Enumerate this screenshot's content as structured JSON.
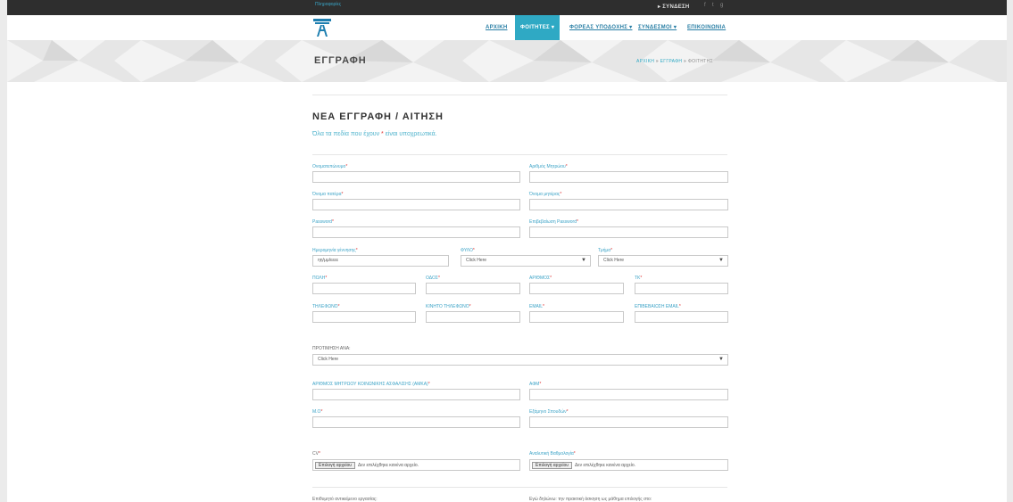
{
  "topbar": {
    "hint": "Πληροφορίες",
    "login_label": "ΣΥΝΔΕΣΗ",
    "social": [
      "f",
      "t",
      "g"
    ]
  },
  "nav": {
    "items": [
      {
        "label": "ΑΡΧΙΚΗ"
      },
      {
        "label": "ΦΟΙΤΗΤΕΣ ▾"
      },
      {
        "label": "ΦΟΡΕΑΣ ΥΠΟΔΟΧΗΣ ▾"
      },
      {
        "label": "ΣΥΝΔΕΣΜΟΙ ▾"
      },
      {
        "label": "ΕΠΙΚΟΙΝΩΝΙΑ"
      }
    ]
  },
  "banner": {
    "title": "ΕΓΓΡΑΦΗ",
    "crumb_1": "ΑΡΧΙΚΗ",
    "crumb_2": "ΕΓΓΡΑΦΗ",
    "crumb_3": "ΦΟΙΤΗΤΗΣ",
    "separator": "»"
  },
  "form": {
    "title": "ΝΕΑ ΕΓΓΡΑΦΗ / ΑΙΤΗΣΗ",
    "subtitle_before": "Όλα τα πεδία που έχουν ",
    "subtitle_star": "*",
    "subtitle_after": " είναι υποχρεωτικά.",
    "required_mark": "*",
    "fields": {
      "fullname": {
        "label": "Ονοματεπώνυμο",
        "value": ""
      },
      "reg_number": {
        "label": "Αριθμός Μητρώου",
        "value": ""
      },
      "father_name": {
        "label": "Όνομα πατέρα",
        "value": ""
      },
      "mother_name": {
        "label": "Όνομα μητέρας",
        "value": ""
      },
      "password": {
        "label": "Password",
        "value": ""
      },
      "password_confirm": {
        "label": "Επιβεβαίωση Password",
        "value": ""
      },
      "birth_date": {
        "label": "Ημερομηνία γέννησης",
        "value": "",
        "placeholder": "ηη/μμ/εεεε"
      },
      "gender": {
        "label": "ΦΥΛΟ",
        "value": "Click Here"
      },
      "department": {
        "label": "Τμήμα",
        "value": "Click Here"
      },
      "city": {
        "label": "ΠΟΛΗ",
        "value": ""
      },
      "street": {
        "label": "ΟΔΟΣ",
        "value": ""
      },
      "number": {
        "label": "ΑΡΙΘΜΟΣ",
        "value": ""
      },
      "zip": {
        "label": "ΤΚ",
        "value": ""
      },
      "phone": {
        "label": "ΤΗΛΕΦΩΝΟ",
        "value": ""
      },
      "mobile": {
        "label": "ΚΙΝΗΤΟ ΤΗΛΕΦΩΝΟ",
        "value": ""
      },
      "email": {
        "label": "EMAIL",
        "value": ""
      },
      "email_confirm": {
        "label": "ΕΠΙΒΕΒΑΙΩΣΗ EMAIL",
        "value": ""
      },
      "preference": {
        "label": "ΠΡΟΤΙΜΗΣΗ ΑΝΑ:",
        "value": "Click Here"
      },
      "amka": {
        "label": "ΑΡΙΘΜΟΣ ΜΗΤΡΩΟΥ ΚΟΙΝΩΝΙΚΗΣ ΑΣΦΑΛΙΣΗΣ (ΑΜΚΑ)",
        "value": ""
      },
      "afm": {
        "label": "ΑΦΜ",
        "value": ""
      },
      "gpa": {
        "label": "Μ.Ο",
        "value": ""
      },
      "study_year": {
        "label": "Εξάμηνο Σπουδών",
        "value": ""
      },
      "cv": {
        "label": "CV",
        "button": "Επιλογή αρχείου",
        "status": "Δεν επιλέχθηκε κανένα αρχείο."
      },
      "transcript": {
        "label": "Αναλυτική Βαθμολογία",
        "button": "Επιλογή αρχείου",
        "status": "Δεν επιλέχθηκε κανένα αρχείο."
      }
    },
    "footer_left": "Επιθυμητό αντικείμενο εργασίας:",
    "footer_right": "Εγώ δηλώνω: την πρακτική άσκηση ως μάθημα επιλογής στο:"
  },
  "colors": {
    "accent": "#2fa9c4",
    "required": "#e03131",
    "topbar": "#2e2e2e"
  }
}
